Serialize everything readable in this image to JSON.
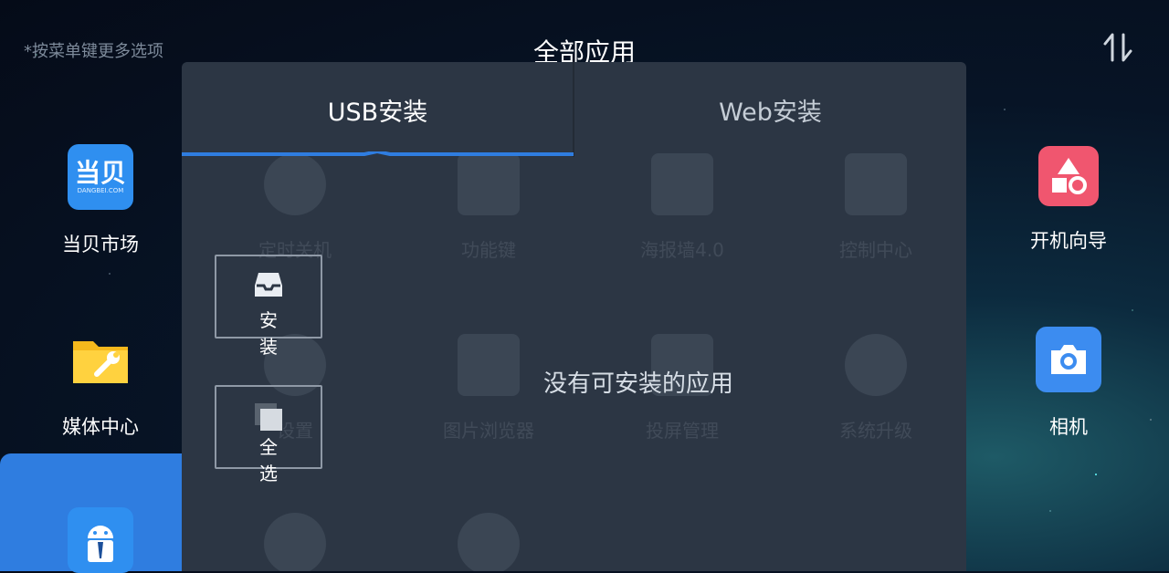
{
  "header": {
    "hint": "*按菜单键更多选项",
    "title": "全部应用",
    "sort_icon": "sort-arrows-icon"
  },
  "left_apps": [
    {
      "label": "当贝市场",
      "icon": "dangbei-market-icon",
      "icon_text": "当贝",
      "icon_subtext": "DANGBEI.COM",
      "color": "#2f8ff0"
    },
    {
      "label": "媒体中心",
      "icon": "folder-wrench-icon",
      "color": "#f5b81c"
    },
    {
      "label": "",
      "icon": "android-app-icon",
      "color": "#2f8ff0"
    }
  ],
  "right_apps": [
    {
      "label": "开机向导",
      "icon": "shapes-icon",
      "color": "#f0566f"
    },
    {
      "label": "相机",
      "icon": "camera-icon",
      "color": "#3c8cf0"
    }
  ],
  "background_apps": [
    {
      "label": "定时关机"
    },
    {
      "label": "功能键"
    },
    {
      "label": "海报墙4.0"
    },
    {
      "label": "控制中心"
    },
    {
      "label": "设置"
    },
    {
      "label": "图片浏览器"
    },
    {
      "label": "投屏管理"
    },
    {
      "label": "系统升级"
    },
    {
      "label": ""
    },
    {
      "label": ""
    }
  ],
  "dialog": {
    "tabs": [
      {
        "label": "USB安装",
        "active": true
      },
      {
        "label": "Web安装",
        "active": false
      }
    ],
    "accent": "#2f7de0",
    "buttons": [
      {
        "label": "安 装",
        "icon": "install-tray-icon"
      },
      {
        "label": "全 选",
        "icon": "select-all-icon"
      }
    ],
    "empty_message": "没有可安装的应用"
  }
}
